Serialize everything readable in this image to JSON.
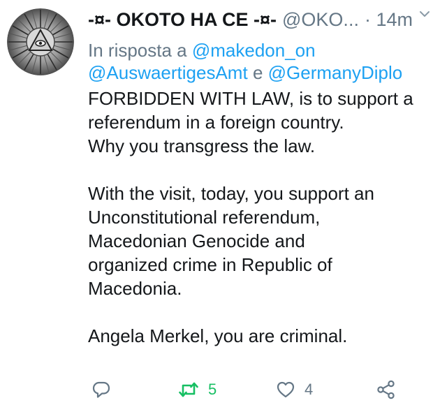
{
  "tweet": {
    "display_name": "-¤- OKOTO HA CE -¤-",
    "handle": "@OKO...",
    "time": "· 14m",
    "reply_prefix": "In risposta a",
    "mention_1": "@makedon_on",
    "mention_2": "@AuswaertigesAmt",
    "mention_joiner": "e",
    "mention_3": "@GermanyDiplo",
    "lines": [
      "FORBIDDEN WITH LAW, is to support a",
      "referendum in a foreign country.",
      "Why you  transgress the law.",
      "With the visit, today,  you support an",
      "Unconstitutional referendum,",
      "Macedonian Genocide and",
      "organized crime  in Republic of",
      "Macedonia.",
      "Angela Merkel, you are criminal."
    ]
  },
  "actions": {
    "reply_icon": "reply-icon",
    "retweet_icon": "retweet-icon",
    "retweet_count": "5",
    "like_icon": "heart-icon",
    "like_count": "4",
    "share_icon": "share-icon"
  },
  "colors": {
    "link": "#1da1f2",
    "muted": "#657786",
    "retweet_active": "#17bf63",
    "text": "#14171a"
  }
}
